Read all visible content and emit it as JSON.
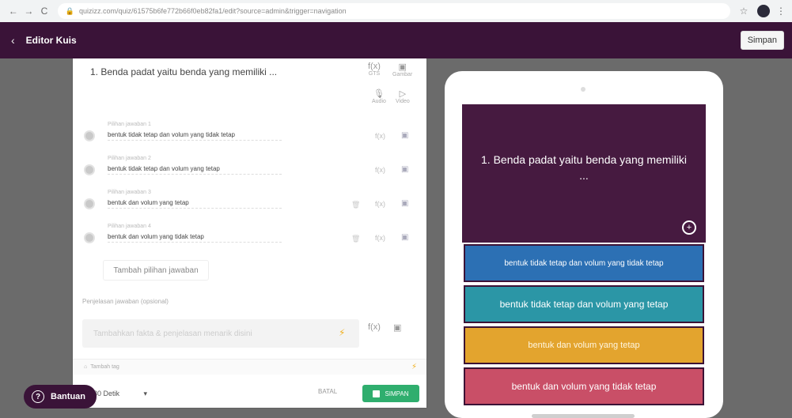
{
  "browser": {
    "back": "←",
    "forward": "→",
    "reload": "C",
    "url": "quizizz.com/quiz/61575b6fe772b66f0eb82fa1/edit?source=admin&trigger=navigation"
  },
  "header": {
    "title": "Editor Kuis",
    "save_label": "Simpan"
  },
  "editor": {
    "question": "1. Benda padat yaitu benda yang memiliki ...",
    "tools_top": [
      {
        "glyph": "f(x)",
        "label": "GTS"
      },
      {
        "glyph": "▣",
        "label": "Gambar"
      },
      {
        "glyph": "🎙",
        "label": "Audio"
      },
      {
        "glyph": "▷",
        "label": "Video"
      }
    ],
    "options": [
      {
        "label": "Pilihan jawaban 1",
        "text": "bentuk tidak tetap dan volum yang tidak tetap"
      },
      {
        "label": "Pilihan jawaban 2",
        "text": "bentuk tidak tetap dan volum yang tetap"
      },
      {
        "label": "Pilihan jawaban 3",
        "text": "bentuk dan volum yang tetap"
      },
      {
        "label": "Pilihan jawaban 4",
        "text": "bentuk dan volum yang tidak tetap"
      }
    ],
    "add_option": "Tambah pilihan jawaban",
    "explanation_label": "Penjelasan jawaban (opsional)",
    "explanation_placeholder": "Tambahkan fakta & penjelasan menarik disini",
    "tag_label": "Tambah tag",
    "time_value": "30 Detik",
    "cancel_label": "BATAL",
    "save_label": "SIMPAN"
  },
  "help": {
    "label": "Bantuan"
  },
  "preview": {
    "question": "1. Benda padat yaitu benda yang memiliki ...",
    "answers": [
      "bentuk tidak tetap dan volum yang tidak tetap",
      "bentuk tidak tetap dan volum yang tetap",
      "bentuk dan volum yang tetap",
      "bentuk dan volum yang tidak tetap"
    ]
  },
  "colors": {
    "header_bg": "#3a1338",
    "answer_1": "#2c70b4",
    "answer_2": "#2b96a6",
    "answer_3": "#e3a42e",
    "answer_4": "#c94f67",
    "save_green": "#2fae6e"
  },
  "icons": [
    "back-icon",
    "forward-icon",
    "reload-icon",
    "lock-icon",
    "star-icon",
    "profile-avatar",
    "menu-icon",
    "chevron-left-icon",
    "math-icon",
    "image-icon",
    "mic-icon",
    "video-icon",
    "trash-icon",
    "bolt-icon",
    "tag-icon",
    "zoom-in-icon",
    "help-icon"
  ]
}
